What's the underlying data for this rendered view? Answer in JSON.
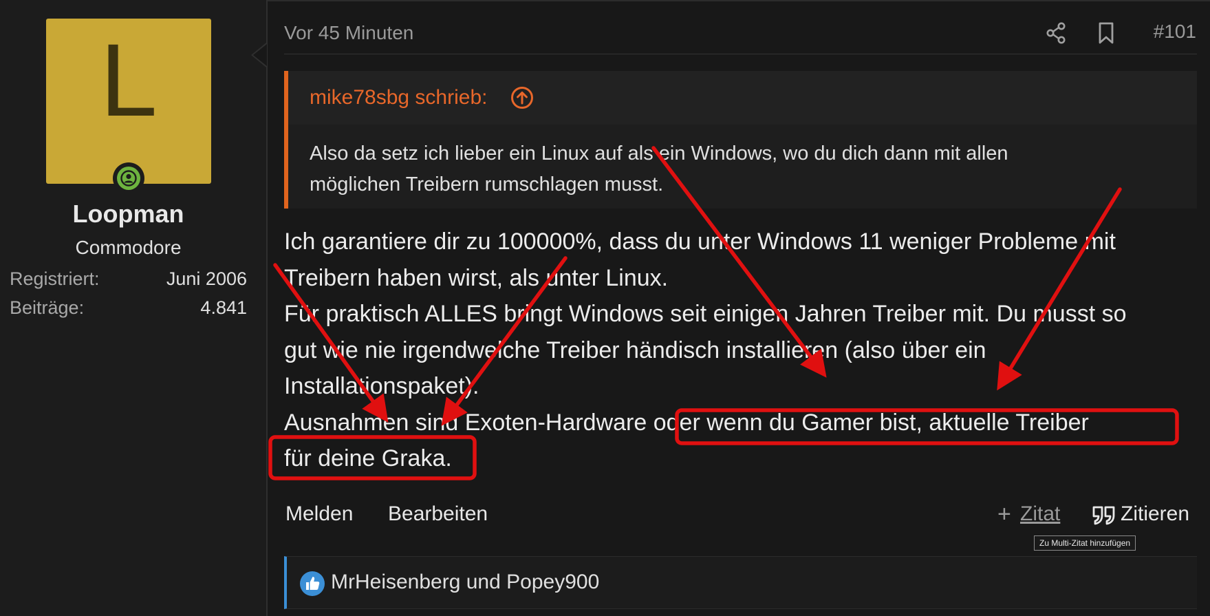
{
  "user": {
    "avatar_letter": "L",
    "name": "Loopman",
    "title": "Commodore",
    "stats": [
      {
        "label": "Registriert:",
        "value": "Juni 2006"
      },
      {
        "label": "Beiträge:",
        "value": "4.841"
      }
    ]
  },
  "post": {
    "time": "Vor 45 Minuten",
    "number": "#101",
    "quote": {
      "author": "mike78sbg schrieb:",
      "lines": [
        "Also da setz ich lieber ein Linux auf als ein Windows, wo du dich dann mit allen",
        "möglichen Treibern rumschlagen musst."
      ]
    },
    "body_lines": [
      "Ich garantiere dir zu 100000%, dass du unter Windows 11 weniger Probleme mit",
      "Treibern haben wirst, als unter Linux.",
      "Für praktisch ALLES bringt Windows seit einigen Jahren Treiber mit. Du musst so",
      "gut wie nie irgendwelche Treiber händisch installieren (also über ein",
      "Installationspaket).",
      "Ausnahmen sind Exoten-Hardware oder wenn du Gamer bist, aktuelle Treiber",
      "für deine Graka."
    ]
  },
  "actions": {
    "report": "Melden",
    "edit": "Bearbeiten",
    "multiquote_plus": "+",
    "multiquote": "Zitat",
    "quote": "Zitieren",
    "tooltip": "Zu Multi-Zitat hinzufügen"
  },
  "reactions": {
    "text": "MrHeisenberg und Popey900"
  },
  "colors": {
    "accent_quote": "#e0641e",
    "annotation_red": "#e01010",
    "reaction_blue": "#3b8fd6",
    "avatar_bg": "#c9a836"
  },
  "icons": [
    "user-icon",
    "share-icon",
    "bookmark-icon",
    "arrow-up-circle-icon",
    "quote-icon",
    "thumbs-up-icon"
  ]
}
